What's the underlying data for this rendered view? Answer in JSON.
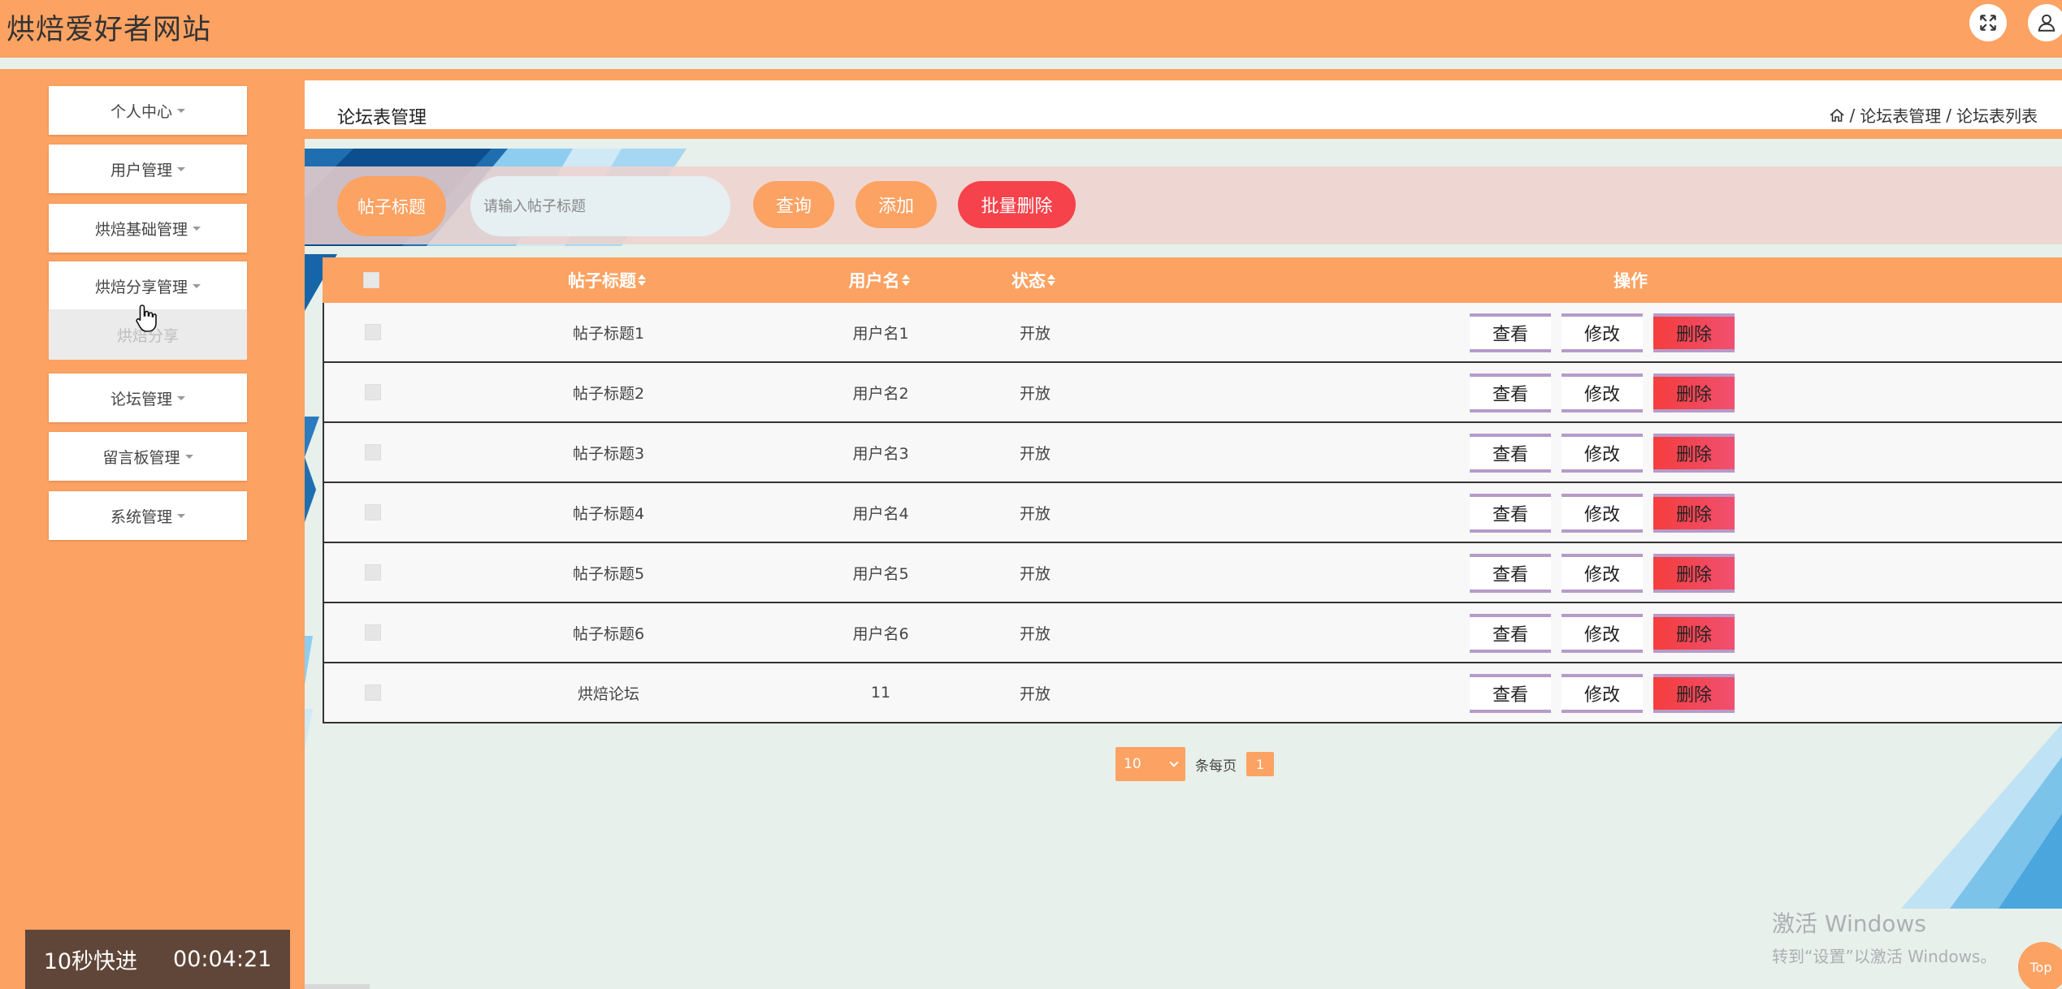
{
  "header": {
    "site_title": "烘焙爱好者网站",
    "icons": [
      "fullscreen-icon",
      "user-icon"
    ]
  },
  "sidebar": {
    "items": [
      {
        "label": "个人中心"
      },
      {
        "label": "用户管理"
      },
      {
        "label": "烘焙基础管理"
      },
      {
        "label": "烘焙分享管理"
      },
      {
        "label": "论坛管理"
      },
      {
        "label": "留言板管理"
      },
      {
        "label": "系统管理"
      }
    ],
    "submenu_item": "烘焙分享"
  },
  "timer": {
    "label": "10秒快进",
    "time": "00:04:21"
  },
  "page": {
    "title": "论坛表管理",
    "breadcrumb": {
      "level1": "论坛表管理",
      "level2": "论坛表列表",
      "sep": "/"
    }
  },
  "search": {
    "label": "帖子标题",
    "placeholder": "请输入帖子标题",
    "query_btn": "查询",
    "add_btn": "添加",
    "batch_delete_btn": "批量删除"
  },
  "table": {
    "headers": {
      "title": "帖子标题",
      "username": "用户名",
      "status": "状态",
      "ops": "操作"
    },
    "rows": [
      {
        "title": "帖子标题1",
        "username": "用户名1",
        "status": "开放"
      },
      {
        "title": "帖子标题2",
        "username": "用户名2",
        "status": "开放"
      },
      {
        "title": "帖子标题3",
        "username": "用户名3",
        "status": "开放"
      },
      {
        "title": "帖子标题4",
        "username": "用户名4",
        "status": "开放"
      },
      {
        "title": "帖子标题5",
        "username": "用户名5",
        "status": "开放"
      },
      {
        "title": "帖子标题6",
        "username": "用户名6",
        "status": "开放"
      },
      {
        "title": "烘焙论坛",
        "username": "11",
        "status": "开放"
      }
    ],
    "actions": {
      "view": "查看",
      "edit": "修改",
      "delete": "删除"
    }
  },
  "pagination": {
    "page_size": "10",
    "per_page_label": "条每页",
    "current_page": "1"
  },
  "watermark": {
    "line1": "激活 Windows",
    "line2": "转到“设置”以激活 Windows。"
  },
  "top_button": "Top",
  "colors": {
    "primary": "#fca262",
    "danger": "#f5424b",
    "background": "#e7f0ea",
    "timer_bg": "#5f4638"
  }
}
